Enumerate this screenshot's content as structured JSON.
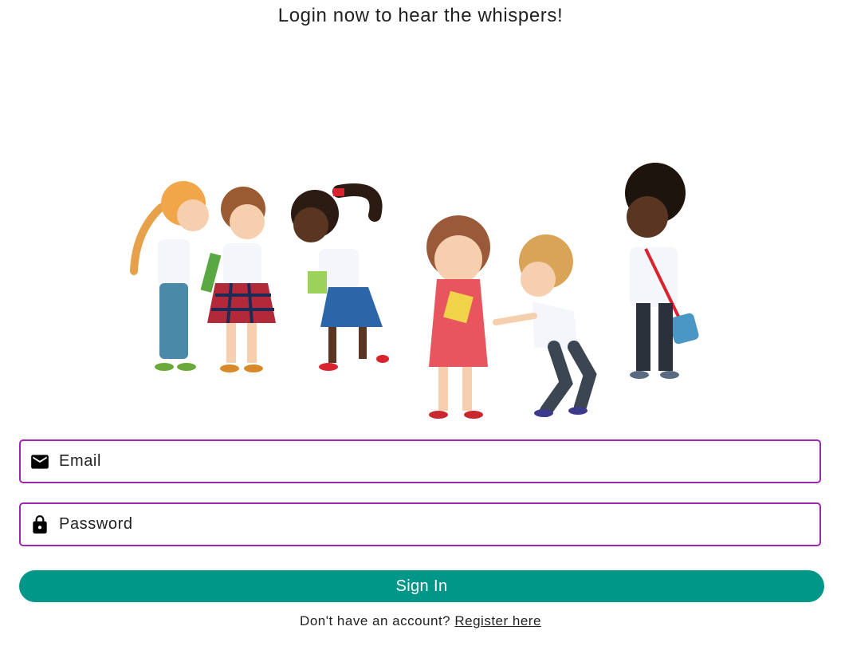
{
  "header": {
    "title": "Login now to hear the whispers!"
  },
  "illustration": {
    "name": "children-whispering-illustration"
  },
  "form": {
    "email": {
      "placeholder": "Email",
      "icon": "mail-icon"
    },
    "password": {
      "placeholder": "Password",
      "icon": "lock-icon"
    },
    "submit_label": "Sign In"
  },
  "footer": {
    "prompt": "Don't have an account?",
    "register_label": "Register here"
  },
  "colors": {
    "field_border": "#9c27b0",
    "button_bg": "#009688",
    "button_text": "#ffffff"
  }
}
